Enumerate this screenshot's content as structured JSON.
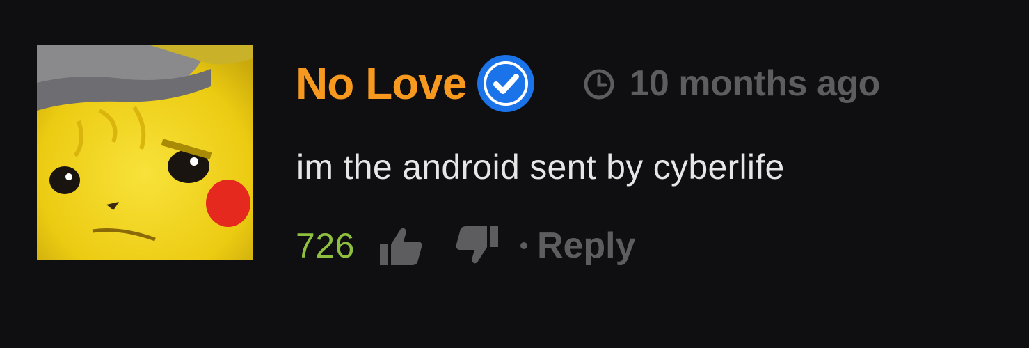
{
  "comment": {
    "avatar_icon": "pikachu-detective-avatar",
    "username": "No Love",
    "verified_icon": "verified-check-icon",
    "timestamp_icon": "clock-icon",
    "timestamp": "10 months ago",
    "text": "im the android sent by cyberlife",
    "likes": "726",
    "like_icon": "thumbs-up-icon",
    "dislike_icon": "thumbs-down-icon",
    "reply_label": "Reply"
  },
  "colors": {
    "background": "#0f0e10",
    "username": "#f7991e",
    "verified_badge": "#1a73e8",
    "muted": "#5d5d5f",
    "likes": "#8fbf3e",
    "text": "#e6e6e6"
  }
}
